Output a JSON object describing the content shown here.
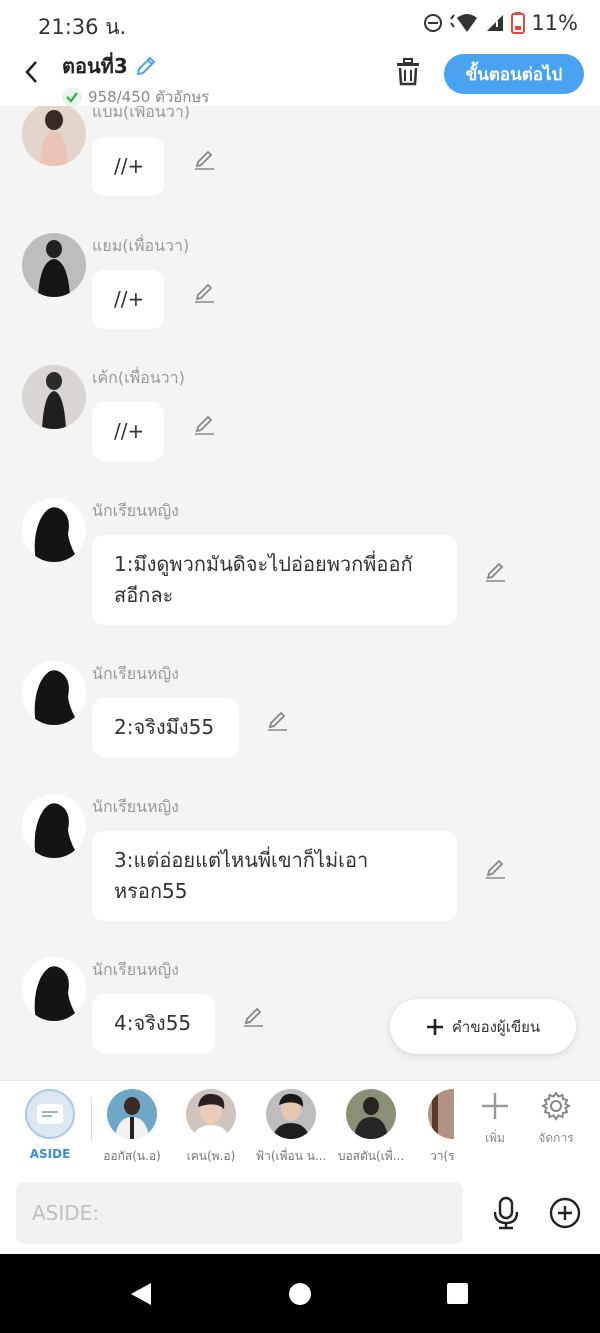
{
  "status_bar": {
    "time": "21:36 น.",
    "battery": "11%"
  },
  "header": {
    "title": "ตอนที่3",
    "char_count": "958/450 ตัวอักษร",
    "next_label": "ขั้นตอนต่อไป"
  },
  "messages": [
    {
      "sender": "แบม(เพื่อนวา)",
      "text": "//+"
    },
    {
      "sender": "แยม(เพื่อนวา)",
      "text": "//+"
    },
    {
      "sender": "เค้ก(เพื่อนวา)",
      "text": "//+"
    },
    {
      "sender": "นักเรียนหญิง",
      "text": "1:มึงดูพวกมันดิจะไปอ่อยพวกพี่ออกัสอีกละ"
    },
    {
      "sender": "นักเรียนหญิง",
      "text": "2:จริงมึง55"
    },
    {
      "sender": "นักเรียนหญิง",
      "text": "3:แต่อ่อยแต่ไหนพี่เขาก็ไม่เอาหรอก55"
    },
    {
      "sender": "นักเรียนหญิง",
      "text": "4:จริง55"
    }
  ],
  "author_button": {
    "label": "คำของผู้เขียน"
  },
  "characters": [
    {
      "label": "ASIDE"
    },
    {
      "label": "ออกัส(น.อ)"
    },
    {
      "label": "เคน(พ.อ)"
    },
    {
      "label": "ฟ้า(เพื่อน น..."
    },
    {
      "label": "บอสตัน(เพื่..."
    },
    {
      "label": "วา(ร"
    }
  ],
  "tools": {
    "add_label": "เพิ่ม",
    "manage_label": "จัดการ"
  },
  "input": {
    "placeholder": "ASIDE:"
  }
}
